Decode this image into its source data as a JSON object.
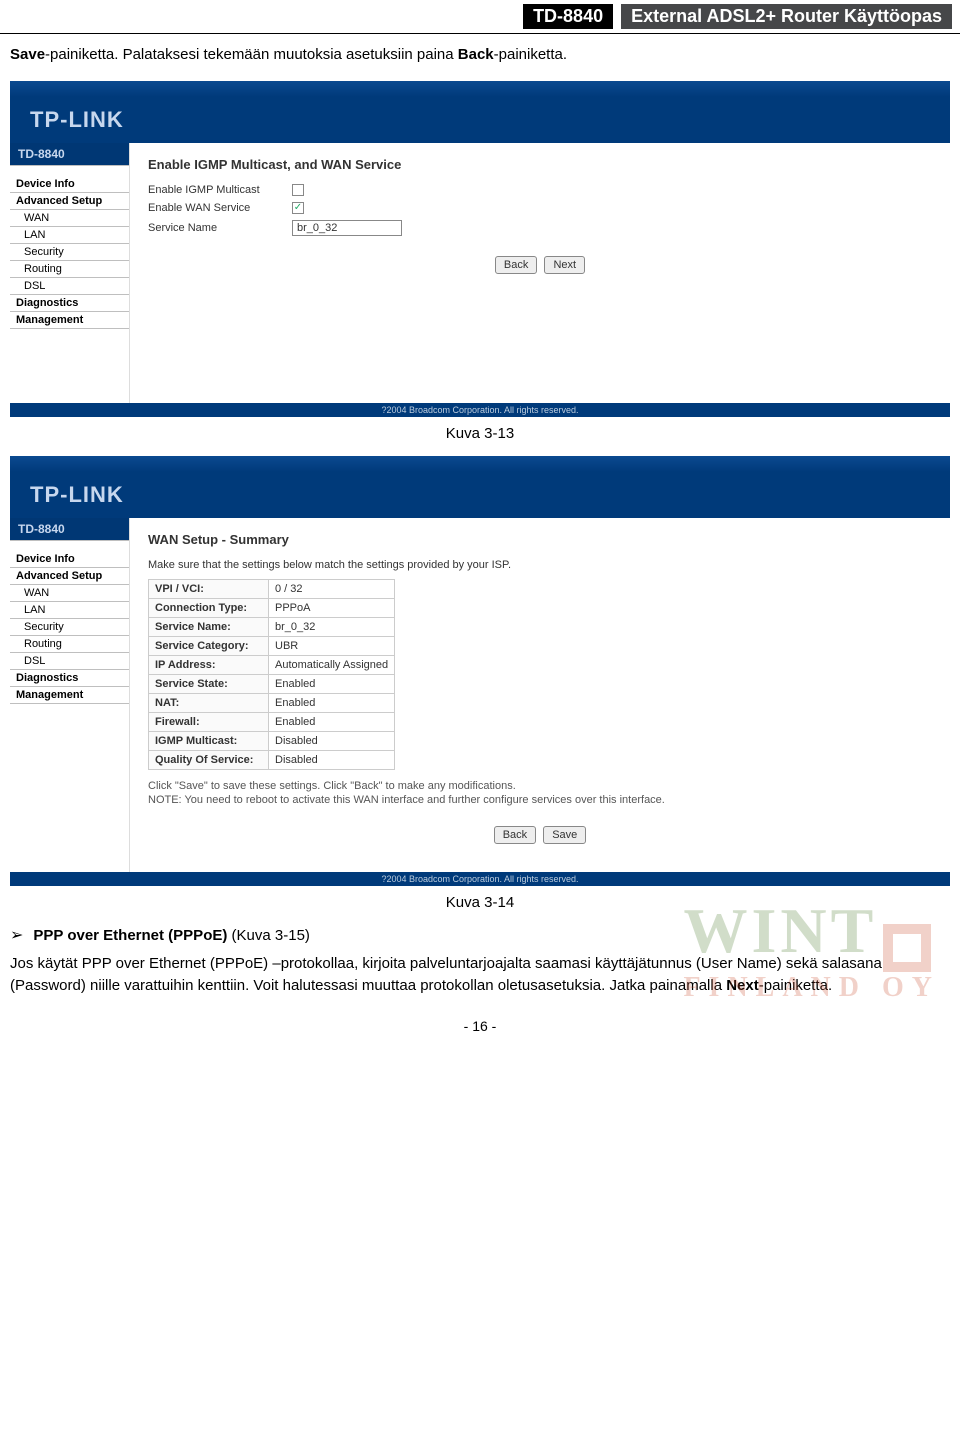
{
  "header": {
    "model": "TD-8840",
    "title": "External ADSL2+ Router Käyttöopas"
  },
  "intro": {
    "pre": "Save",
    "mid": "-painiketta. Palataksesi tekemään muutoksia asetuksiin paina ",
    "bold2": "Back",
    "post": "-painiketta."
  },
  "logo": "TP-LINK",
  "device": "TD-8840",
  "nav": [
    "Device Info",
    "Advanced Setup",
    "WAN",
    "LAN",
    "Security",
    "Routing",
    "DSL",
    "Diagnostics",
    "Management"
  ],
  "shot1": {
    "title": "Enable IGMP Multicast, and WAN Service",
    "row1": "Enable IGMP Multicast",
    "row2": "Enable WAN Service",
    "row3": "Service Name",
    "service_value": "br_0_32",
    "btn_back": "Back",
    "btn_next": "Next"
  },
  "caption1": "Kuva 3-13",
  "shot2": {
    "title": "WAN Setup - Summary",
    "lead": "Make sure that the settings below match the settings provided by your ISP.",
    "rows": [
      {
        "k": "VPI / VCI:",
        "v": "0 / 32"
      },
      {
        "k": "Connection Type:",
        "v": "PPPoA"
      },
      {
        "k": "Service Name:",
        "v": "br_0_32"
      },
      {
        "k": "Service Category:",
        "v": "UBR"
      },
      {
        "k": "IP Address:",
        "v": "Automatically Assigned"
      },
      {
        "k": "Service State:",
        "v": "Enabled"
      },
      {
        "k": "NAT:",
        "v": "Enabled"
      },
      {
        "k": "Firewall:",
        "v": "Enabled"
      },
      {
        "k": "IGMP Multicast:",
        "v": "Disabled"
      },
      {
        "k": "Quality Of Service:",
        "v": "Disabled"
      }
    ],
    "note1": "Click \"Save\" to save these settings. Click \"Back\" to make any modifications.",
    "note2": "NOTE: You need to reboot to activate this WAN interface and further configure services over this interface.",
    "btn_back": "Back",
    "btn_save": "Save"
  },
  "copyright": "?2004 Broadcom Corporation. All rights reserved.",
  "caption2": "Kuva 3-14",
  "bullet": {
    "arrow": "➢",
    "text": "PPP over Ethernet (PPPoE) ",
    "suffix": "(Kuva 3-15)"
  },
  "para2": {
    "a": "Jos käytät PPP over Ethernet (PPPoE) –protokollaa, kirjoita palveluntarjoajalta saamasi käyttäjätunnus (User Name) sekä salasana (Password) niille varattuihin kenttiin. Voit halutessasi muuttaa protokollan oletusasetuksia. Jatka painamalla ",
    "bold": "Next",
    "b": "-painiketta."
  },
  "watermark": {
    "top": "WINT",
    "bot": "FINLAND OY"
  },
  "pagenum": "- 16 -"
}
